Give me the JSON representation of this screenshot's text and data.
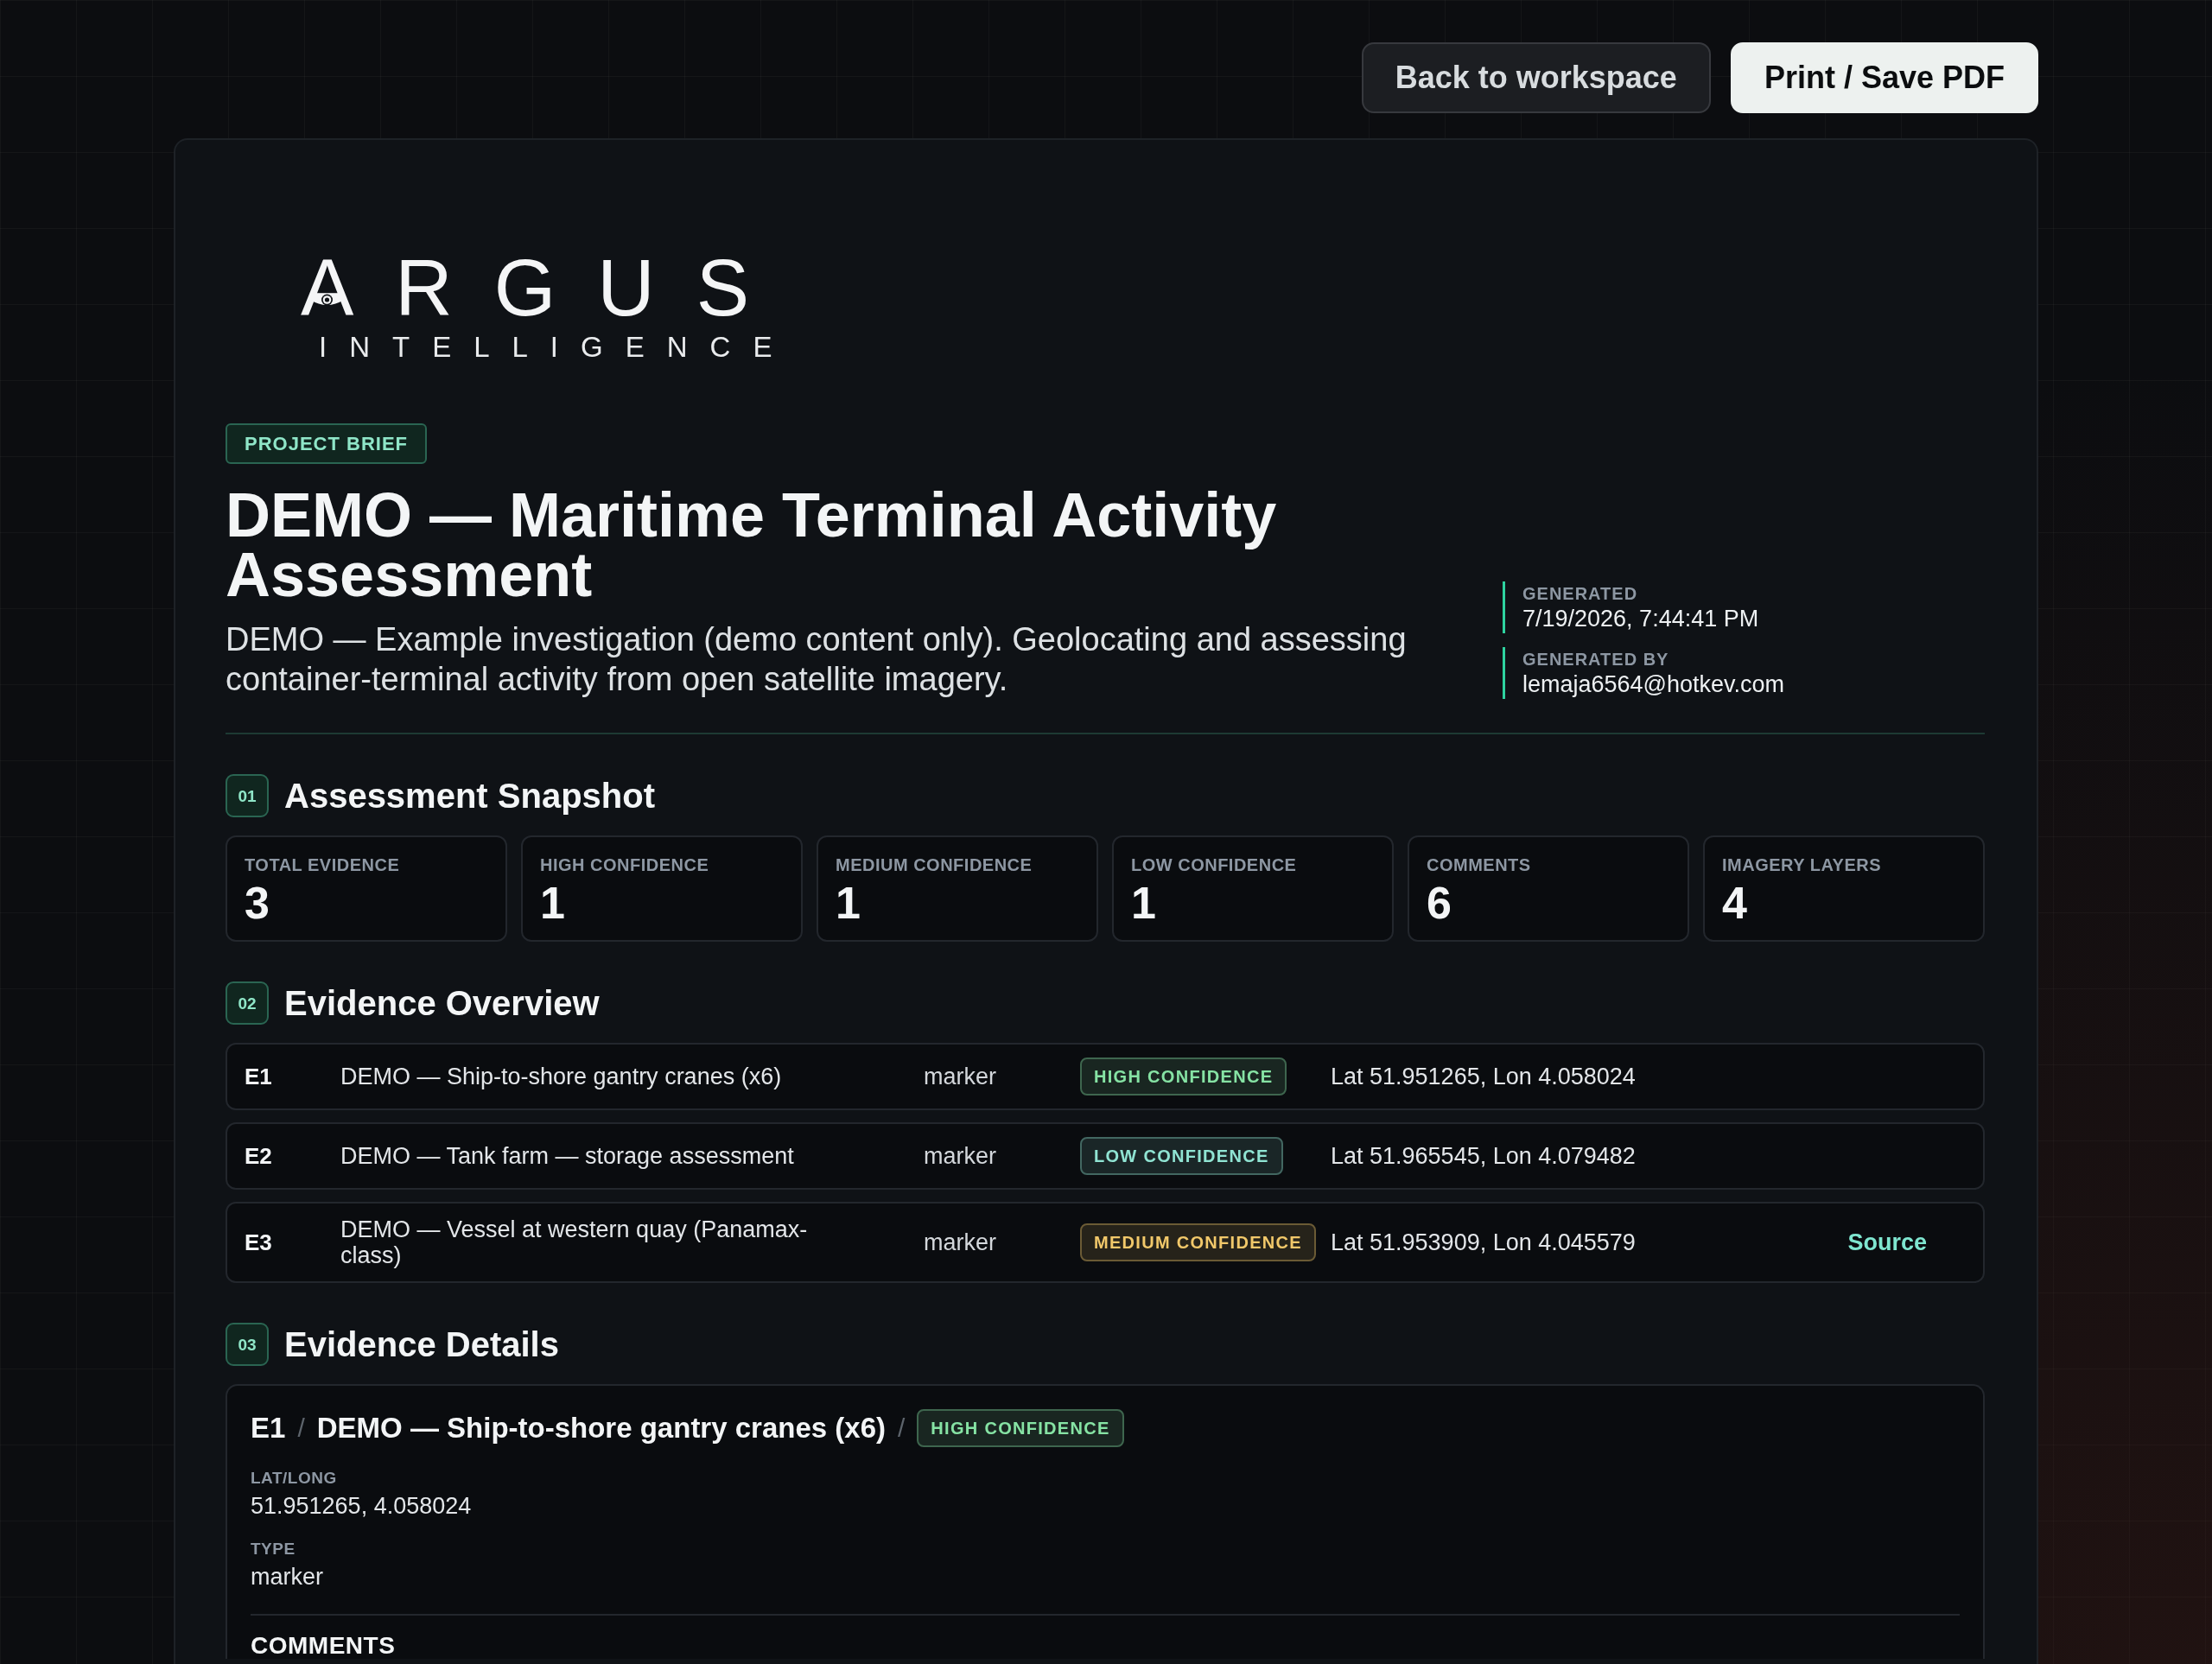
{
  "header_actions": [
    {
      "label": "Back to workspace",
      "kind": "secondary"
    },
    {
      "label": "Print / Save PDF",
      "kind": "primary"
    }
  ],
  "logo": {
    "wordmark": "ARGUS",
    "tagline": "INTELLIGENCE"
  },
  "brief": {
    "badge": "PROJECT BRIEF",
    "title": "DEMO — Maritime Terminal Activity Assessment",
    "description": "DEMO — Example investigation (demo content only). Geolocating and assessing container-terminal activity from open satellite imagery.",
    "meta": [
      {
        "label": "GENERATED",
        "value": "7/19/2026, 7:44:41 PM"
      },
      {
        "label": "GENERATED BY",
        "value": "lemaja6564@hotkev.com"
      }
    ]
  },
  "sections": [
    {
      "number": "01",
      "title": "Assessment Snapshot",
      "kind": "stats",
      "stats": [
        {
          "label": "TOTAL EVIDENCE",
          "value": "3"
        },
        {
          "label": "HIGH CONFIDENCE",
          "value": "1"
        },
        {
          "label": "MEDIUM CONFIDENCE",
          "value": "1"
        },
        {
          "label": "LOW CONFIDENCE",
          "value": "1"
        },
        {
          "label": "COMMENTS",
          "value": "6"
        },
        {
          "label": "IMAGERY LAYERS",
          "value": "4"
        }
      ]
    },
    {
      "number": "02",
      "title": "Evidence Overview",
      "kind": "overview",
      "rows": [
        {
          "id": "E1",
          "title": "DEMO — Ship-to-shore gantry cranes (x6)",
          "type": "marker",
          "confidence_label": "HIGH CONFIDENCE",
          "color": "#86e3a4",
          "location": "Lat 51.951265, Lon 4.058024"
        },
        {
          "id": "E2",
          "title": "DEMO — Tank farm — storage assessment",
          "type": "marker",
          "confidence_label": "LOW CONFIDENCE",
          "color": "#90e4d3",
          "location": "Lat 51.965545, Lon 4.079482"
        },
        {
          "id": "E3",
          "title": "DEMO — Vessel at western quay (Panamax-class)",
          "type": "marker",
          "confidence_label": "MEDIUM CONFIDENCE",
          "color": "#f1c86a",
          "location": "Lat 51.953909, Lon 4.045579",
          "source": "Source"
        }
      ]
    },
    {
      "number": "03",
      "title": "Evidence Details",
      "kind": "details",
      "items": [
        {
          "id": "E1",
          "separators": [
            "/",
            "/"
          ],
          "title": "DEMO — Ship-to-shore gantry cranes (x6)",
          "confidence_label": "HIGH CONFIDENCE",
          "color": "#86e3a4",
          "fields": [
            {
              "label": "LAT/LONG",
              "value": "51.951265, 4.058024"
            },
            {
              "label": "TYPE",
              "value": "marker"
            }
          ],
          "comments_heading": "COMMENTS"
        }
      ]
    }
  ]
}
